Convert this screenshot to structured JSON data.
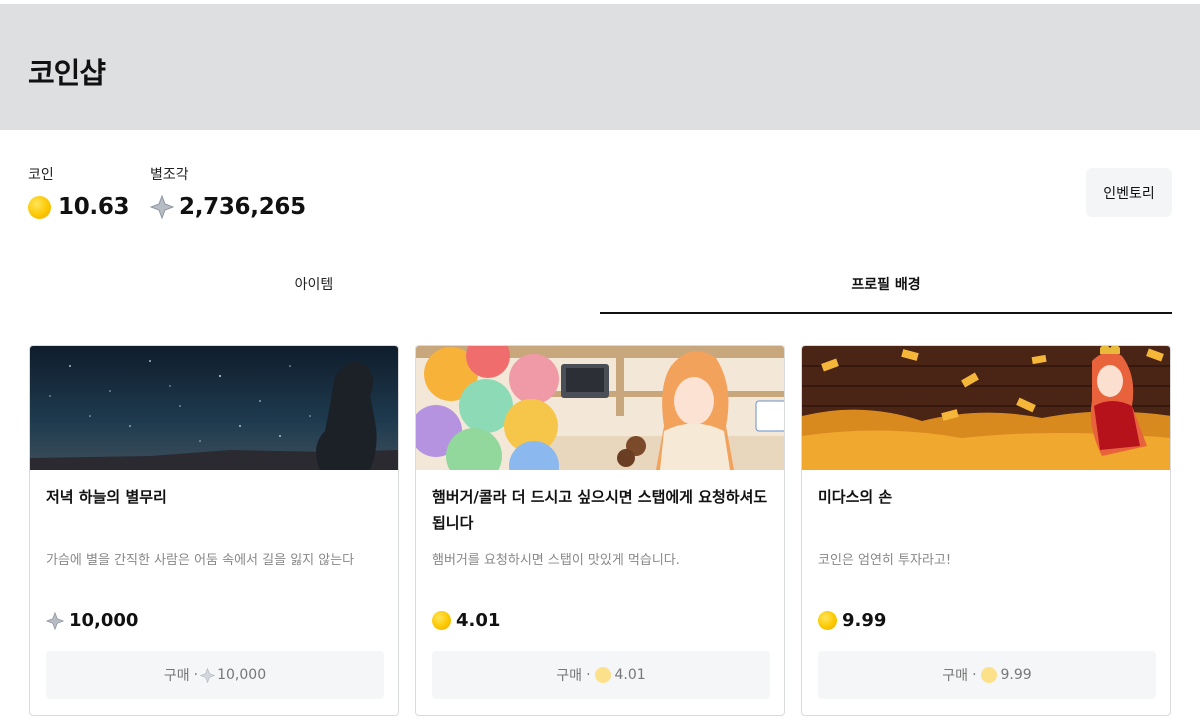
{
  "page": {
    "title": "코인샵"
  },
  "balances": {
    "coin": {
      "label": "코인",
      "value": "10.63",
      "icon": "coin-icon"
    },
    "shard": {
      "label": "별조각",
      "value": "2,736,265",
      "icon": "star-shard-icon"
    }
  },
  "inventory_button": {
    "label": "인벤토리"
  },
  "tabs": [
    {
      "label": "아이템",
      "active": false
    },
    {
      "label": "프로필 배경",
      "active": true
    }
  ],
  "items": [
    {
      "title": "저녁 하늘의 별무리",
      "description": "가슴에 별을 간직한 사람은 어둠 속에서 길을 잃지 않는다",
      "price": "10,000",
      "currency": "shard",
      "buy_label": "구매",
      "buy_sep": "·",
      "buy_price": "10,000"
    },
    {
      "title": "햄버거/콜라 더 드시고 싶으시면 스탭에게 요청하셔도 됩니다",
      "description": "햄버거를 요청하시면 스탭이 맛있게 먹습니다.",
      "price": "4.01",
      "currency": "coin",
      "buy_label": "구매",
      "buy_sep": "·",
      "buy_price": "4.01"
    },
    {
      "title": "미다스의 손",
      "description": "코인은 엄연히 투자라고!",
      "price": "9.99",
      "currency": "coin",
      "buy_label": "구매",
      "buy_sep": "·",
      "buy_price": "9.99"
    }
  ],
  "colors": {
    "header_bg": "#dedfe1",
    "coin": "#fcc800",
    "button_bg": "#f5f6f7"
  }
}
